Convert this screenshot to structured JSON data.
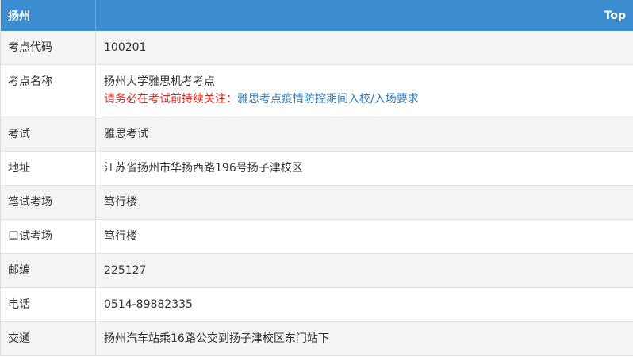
{
  "header": {
    "title": "扬州",
    "top_link": "Top"
  },
  "rows": [
    {
      "label": "考点代码",
      "value": "100201"
    },
    {
      "label": "考点名称",
      "value": "扬州大学雅思机考考点",
      "notice_prefix": "请务必在考试前持续关注：",
      "notice_link": "雅思考点疫情防控期间入校/入场要求"
    },
    {
      "label": "考试",
      "value": "雅思考试"
    },
    {
      "label": "地址",
      "value": "江苏省扬州市华扬西路196号扬子津校区"
    },
    {
      "label": "笔试考场",
      "value": "笃行楼"
    },
    {
      "label": "口试考场",
      "value": "笃行楼"
    },
    {
      "label": "邮编",
      "value": "225127"
    },
    {
      "label": "电话",
      "value": "0514-89882335"
    },
    {
      "label": "交通",
      "value": "扬州汽车站乘16路公交到扬子津校区东门站下"
    }
  ],
  "colors": {
    "header_bg": "#3c8dd0",
    "notice_red": "#e1251b",
    "link_blue": "#2a7ab8"
  }
}
